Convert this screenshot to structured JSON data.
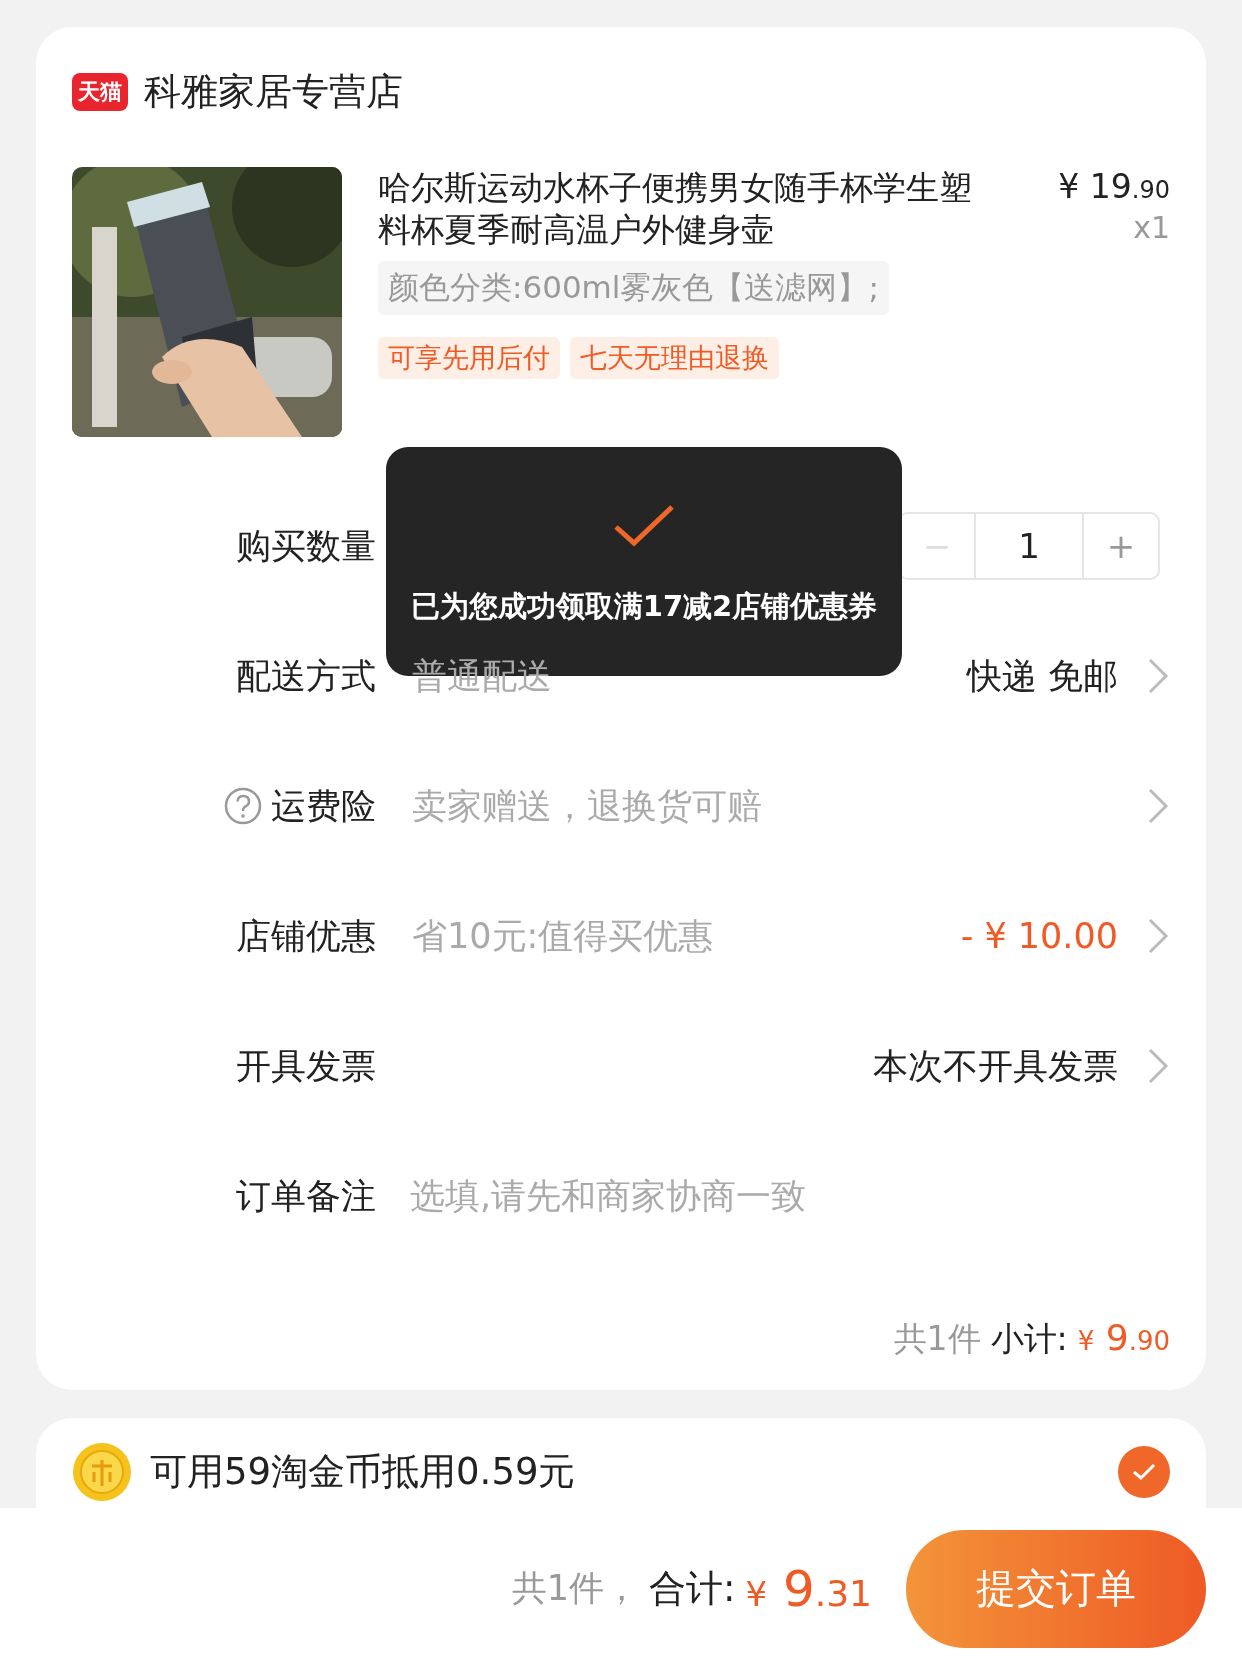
{
  "store": {
    "badge": "天猫",
    "name": "科雅家居专营店"
  },
  "product": {
    "kind": "picture",
    "title": "哈尔斯运动水杯子便携男女随手杯学生塑料杯夏季耐高温户外健身壶",
    "currency": "¥",
    "price_int": "19",
    "price_dec": ".90",
    "quantity": "x1",
    "sku": "颜色分类:600ml雾灰色【送滤网】;",
    "tags": [
      "可享先用后付",
      "七天无理由退换"
    ]
  },
  "rows": [
    {
      "kind": "stepper",
      "label": "购买数量",
      "help": false,
      "minus": "−",
      "value": "1",
      "plus": "+",
      "minus_disabled": true
    },
    {
      "kind": "link",
      "label": "配送方式",
      "help": false,
      "value": "普通配送",
      "right": "快递 免邮"
    },
    {
      "kind": "link",
      "label": "运费险",
      "help": true,
      "value": "卖家赠送，退换货可赔"
    },
    {
      "kind": "discount",
      "label": "店铺优惠",
      "help": false,
      "value": "省10元:值得买优惠",
      "right": "- ¥ 10.00"
    },
    {
      "kind": "link",
      "label": "开具发票",
      "help": false,
      "right": "本次不开具发票"
    },
    {
      "kind": "input",
      "label": "订单备注",
      "help": false,
      "placeholder": "选填,请先和商家协商一致"
    }
  ],
  "subtotal": {
    "count": "共1件",
    "label": "小计:",
    "currency": "¥",
    "int": "9",
    "dec": ".90"
  },
  "coins": {
    "text": "可用59淘金币抵用0.59元",
    "checked": true
  },
  "footer": {
    "count": "共1件，",
    "label": "合计:",
    "currency": "¥",
    "int": "9",
    "dec": ".31",
    "button": "提交订单"
  },
  "toast": {
    "message": "已为您成功领取满17减2店铺优惠券"
  }
}
